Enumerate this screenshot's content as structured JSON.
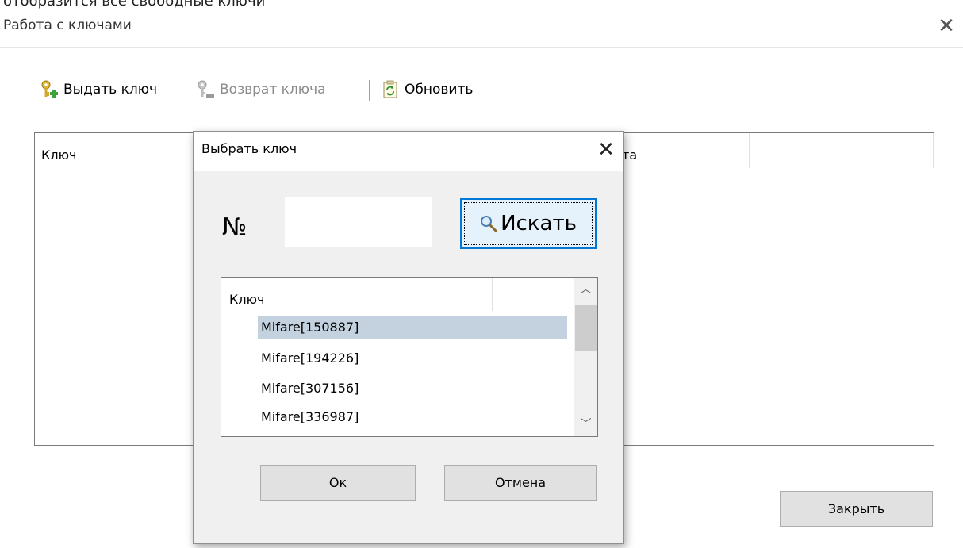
{
  "top_clipped_text": "отобразится все свободные ключи",
  "window": {
    "title": "Работа с ключами",
    "close_symbol": "✕"
  },
  "toolbar": {
    "issue_label": "Выдать ключ",
    "return_label": "Возврат ключа",
    "refresh_label": "Обновить",
    "icons": [
      "key-add-icon",
      "key-remove-icon",
      "refresh-icon"
    ]
  },
  "main_list": {
    "columns": [
      "Ключ",
      "та",
      ""
    ]
  },
  "close_button": "Закрыть",
  "dialog": {
    "title": "Выбрать ключ",
    "close_symbol": "✕",
    "number_label": "№",
    "number_value": "",
    "search_label": "Искать",
    "list_header": "Ключ",
    "keys": [
      "Mifare[150887]",
      "Mifare[194226]",
      "Mifare[307156]",
      "Mifare[336987]"
    ],
    "selected_index": 0,
    "ok_label": "Ок",
    "cancel_label": "Отмена"
  },
  "colors": {
    "selection": "#c4d2e0",
    "focus_border": "#0078d7",
    "button_face": "#e1e1e1"
  }
}
